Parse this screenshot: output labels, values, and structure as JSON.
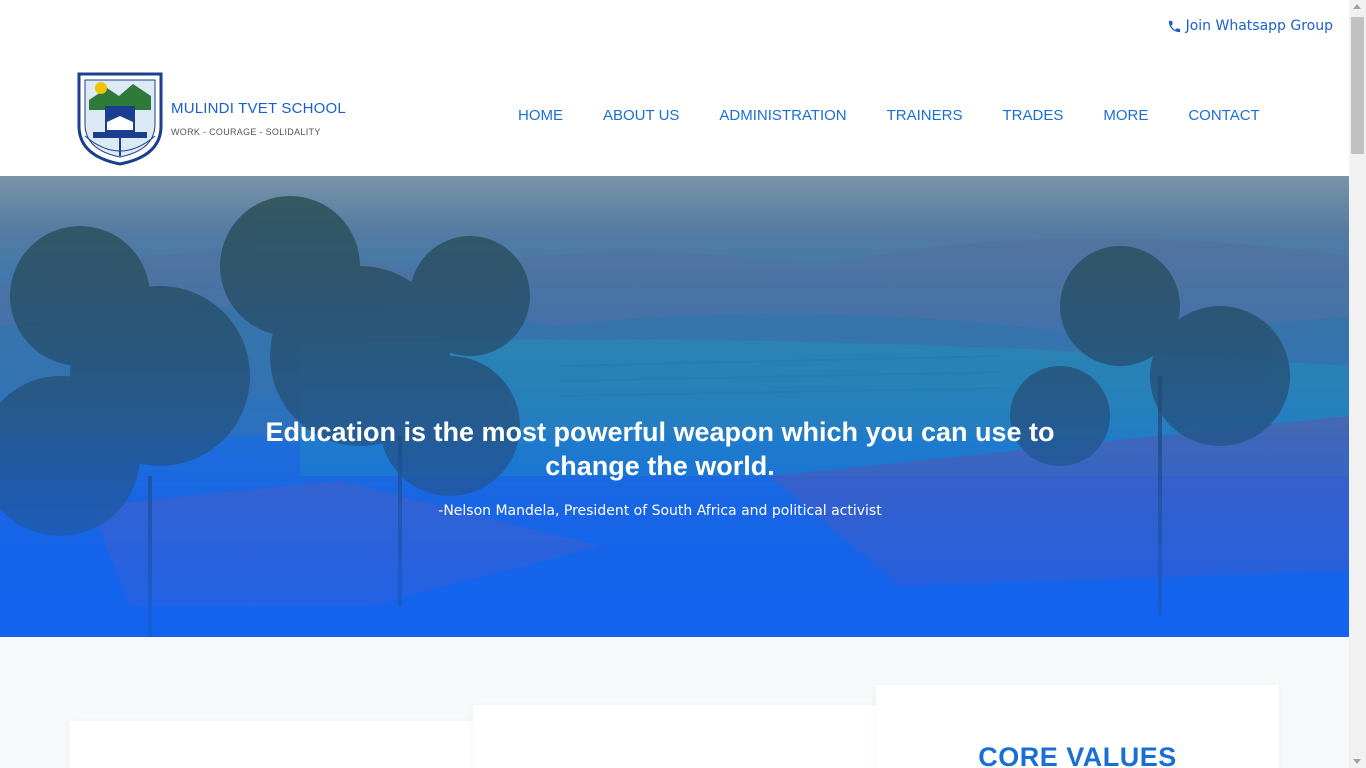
{
  "topbar": {
    "whatsapp_label": "Join Whatsapp Group",
    "whatsapp_icon": "phone-icon"
  },
  "brand": {
    "name": "MULINDI TVET SCHOOL",
    "motto": "WORK - COURAGE - SOLIDALITY",
    "logo_arc_text": "MULINDI TVET SCHOOL"
  },
  "nav": {
    "items": [
      {
        "label": "HOME"
      },
      {
        "label": "ABOUT US"
      },
      {
        "label": "ADMINISTRATION"
      },
      {
        "label": "TRAINERS"
      },
      {
        "label": "TRADES"
      },
      {
        "label": "MORE"
      },
      {
        "label": "CONTACT"
      }
    ]
  },
  "hero": {
    "quote": "Education is the most powerful weapon which you can use to change the world.",
    "attribution": "-Nelson Mandela, President of South Africa and political activist"
  },
  "cards": [
    {
      "title": ""
    },
    {
      "title": ""
    },
    {
      "title": "CORE VALUES"
    }
  ],
  "colors": {
    "accent": "#1a6fd6",
    "hero_overlay": "#1463ef"
  }
}
